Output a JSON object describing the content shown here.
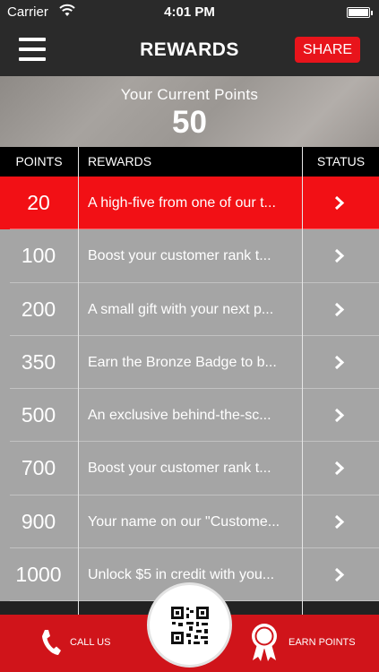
{
  "status_bar": {
    "carrier": "Carrier",
    "time": "4:01 PM"
  },
  "header": {
    "title": "REWARDS",
    "share_label": "SHARE"
  },
  "points_summary": {
    "label": "Your Current Points",
    "value": "50"
  },
  "table": {
    "headers": {
      "points": "POINTS",
      "rewards": "REWARDS",
      "status": "STATUS"
    },
    "rows": [
      {
        "points": "20",
        "reward": "A high-five from one of our t...",
        "active": true
      },
      {
        "points": "100",
        "reward": "Boost your customer rank t..."
      },
      {
        "points": "200",
        "reward": "A small gift with your next p..."
      },
      {
        "points": "350",
        "reward": "Earn the Bronze Badge to b..."
      },
      {
        "points": "500",
        "reward": "An exclusive behind-the-sc..."
      },
      {
        "points": "700",
        "reward": "Boost your customer rank t..."
      },
      {
        "points": "900",
        "reward": "Your name on our \"Custome..."
      },
      {
        "points": "1000",
        "reward": "Unlock $5 in credit with you..."
      }
    ]
  },
  "bottom_bar": {
    "call_label": "CALL US",
    "earn_label": "EARN POINTS"
  },
  "colors": {
    "accent": "#e8141b",
    "row_bg": "#a5a5a5",
    "bottom_bar": "#d0141a",
    "header_bg": "#2a2a2a"
  },
  "icons": [
    "wifi-icon",
    "battery-icon",
    "menu-icon",
    "chevron-right-icon",
    "phone-icon",
    "qr-code-icon",
    "award-ribbon-icon"
  ]
}
